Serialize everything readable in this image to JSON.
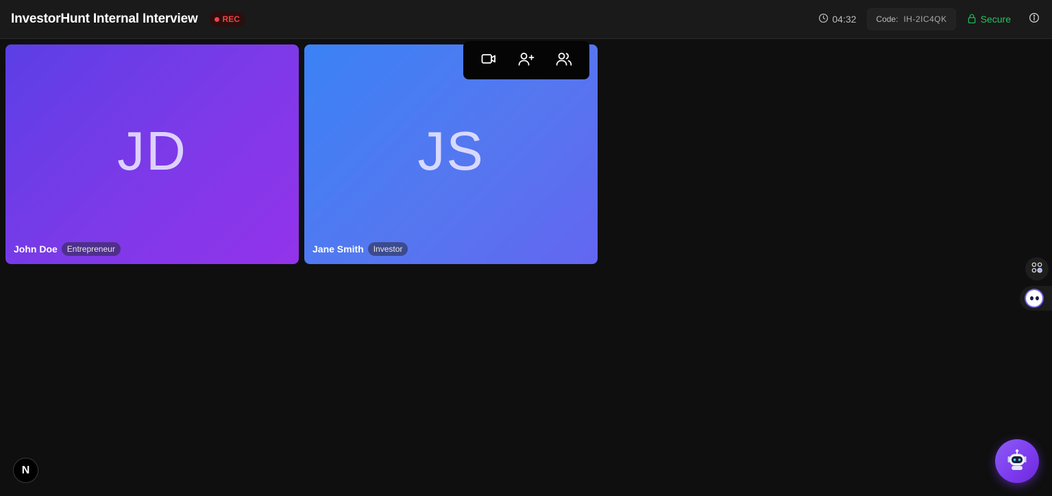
{
  "header": {
    "title": "InvestorHunt Internal Interview",
    "rec_label": "REC",
    "timer": "04:32",
    "code_label": "Code:",
    "code_value": "IH-2IC4QK",
    "secure_label": "Secure"
  },
  "participants": [
    {
      "initials": "JD",
      "name": "John Doe",
      "role": "Entrepreneur"
    },
    {
      "initials": "JS",
      "name": "Jane Smith",
      "role": "Investor"
    }
  ],
  "badge": {
    "letter": "N"
  },
  "colors": {
    "rec": "#ef4444",
    "secure": "#22c55e",
    "tile_1_gradient": [
      "#5b3fe6",
      "#9333ea"
    ],
    "tile_2_gradient": [
      "#3b82f6",
      "#6366f1"
    ],
    "assistant": "#7c3aed"
  },
  "icons": {
    "timer": "clock-icon",
    "secure": "lock-icon",
    "info": "info-icon",
    "toolbar": [
      "video-camera-icon",
      "add-user-icon",
      "users-icon"
    ],
    "side": [
      "apps-icon",
      "bot-icon"
    ],
    "assistant": "robot-icon"
  }
}
